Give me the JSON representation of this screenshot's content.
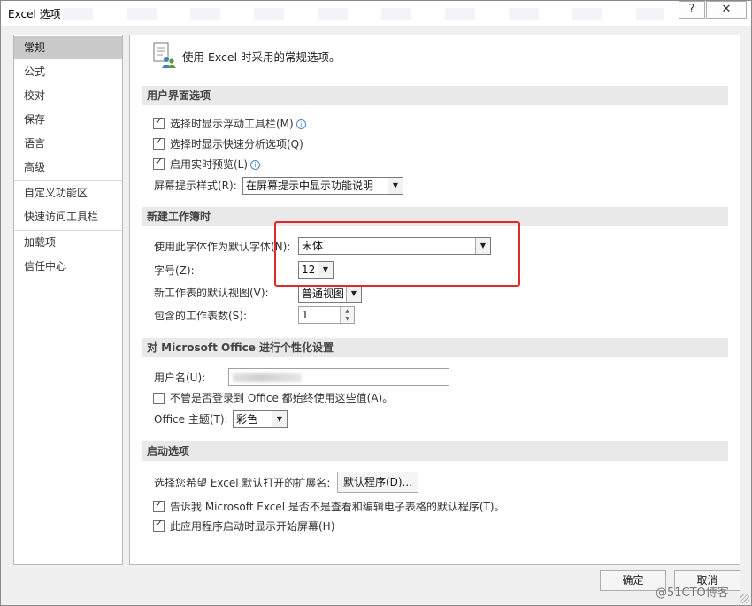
{
  "window": {
    "title": "Excel 选项",
    "help_label": "?",
    "close_label": "✕"
  },
  "nav": {
    "items": [
      "常规",
      "公式",
      "校对",
      "保存",
      "语言",
      "高级",
      "自定义功能区",
      "快速访问工具栏",
      "加载项",
      "信任中心"
    ],
    "selected": "常规"
  },
  "header": {
    "text": "使用 Excel 时采用的常规选项。"
  },
  "sections": {
    "ui": {
      "title": "用户界面选项",
      "show_minitoolbar": {
        "label": "选择时显示浮动工具栏(M)",
        "checked": true
      },
      "show_quick_analysis": {
        "label": "选择时显示快速分析选项(Q)",
        "checked": true
      },
      "live_preview": {
        "label": "启用实时预览(L)",
        "checked": true
      },
      "screentip_label": "屏幕提示样式(R):",
      "screentip_value": "在屏幕提示中显示功能说明"
    },
    "new_workbook": {
      "title": "新建工作簿时",
      "font_label": "使用此字体作为默认字体(N):",
      "font_value": "宋体",
      "size_label": "字号(Z):",
      "size_value": "12",
      "view_label": "新工作表的默认视图(V):",
      "view_value": "普通视图",
      "sheets_label": "包含的工作表数(S):",
      "sheets_value": "1"
    },
    "personalize": {
      "title": "对 Microsoft Office 进行个性化设置",
      "username_label": "用户名(U):",
      "always_use": {
        "label": "不管是否登录到 Office 都始终使用这些值(A)。",
        "checked": false
      },
      "theme_label": "Office 主题(T):",
      "theme_value": "彩色"
    },
    "startup": {
      "title": "启动选项",
      "ext_label": "选择您希望 Excel 默认打开的扩展名:",
      "default_programs_button": "默认程序(D)...",
      "tell_me": {
        "label": "告诉我 Microsoft Excel 是否不是查看和编辑电子表格的默认程序(T)。",
        "checked": true
      },
      "show_start_screen": {
        "label": "此应用程序启动时显示开始屏幕(H)",
        "checked": true
      }
    }
  },
  "footer": {
    "ok_label": "确定",
    "cancel_label": "取消"
  },
  "watermark": "@51CTO博客",
  "colors": {
    "highlight_box": "#e02a2a",
    "section_bg": "#e9e9e9",
    "nav_selected": "#c9c9c9"
  }
}
